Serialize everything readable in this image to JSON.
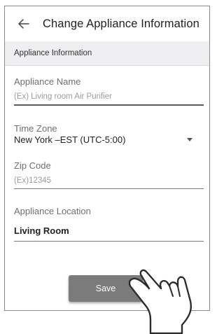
{
  "header": {
    "back_icon": "arrow-left-icon",
    "title": "Change Appliance Information"
  },
  "section": {
    "title": "Appliance Information"
  },
  "fields": {
    "appliance_name": {
      "label": "Appliance Name",
      "placeholder": "(Ex) Living room Air Purifier"
    },
    "time_zone": {
      "label": "Time Zone",
      "value": "New York –EST (UTC-5:00)",
      "icon": "dropdown-caret-icon"
    },
    "zip_code": {
      "label": "Zip Code",
      "placeholder": "(Ex)12345"
    },
    "appliance_location": {
      "label": "Appliance Location",
      "value": "Living Room"
    }
  },
  "actions": {
    "save_label": "Save"
  },
  "overlay": {
    "icon": "pointing-hand-icon"
  }
}
